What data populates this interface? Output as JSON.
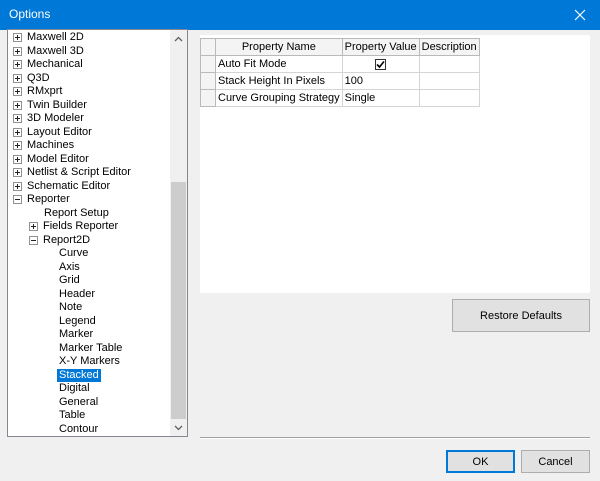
{
  "window": {
    "title": "Options"
  },
  "tree": {
    "items": [
      {
        "label": "Maxwell 2D",
        "level": 0,
        "expander": "plus"
      },
      {
        "label": "Maxwell 3D",
        "level": 0,
        "expander": "plus"
      },
      {
        "label": "Mechanical",
        "level": 0,
        "expander": "plus"
      },
      {
        "label": "Q3D",
        "level": 0,
        "expander": "plus"
      },
      {
        "label": "RMxprt",
        "level": 0,
        "expander": "plus"
      },
      {
        "label": "Twin Builder",
        "level": 0,
        "expander": "plus"
      },
      {
        "label": "3D Modeler",
        "level": 0,
        "expander": "plus"
      },
      {
        "label": "Layout Editor",
        "level": 0,
        "expander": "plus"
      },
      {
        "label": "Machines",
        "level": 0,
        "expander": "plus"
      },
      {
        "label": "Model Editor",
        "level": 0,
        "expander": "plus"
      },
      {
        "label": "Netlist & Script Editor",
        "level": 0,
        "expander": "plus"
      },
      {
        "label": "Schematic Editor",
        "level": 0,
        "expander": "plus"
      },
      {
        "label": "Reporter",
        "level": 0,
        "expander": "minus"
      },
      {
        "label": "Report Setup",
        "level": 1,
        "expander": "none"
      },
      {
        "label": "Fields Reporter",
        "level": 1,
        "expander": "plus"
      },
      {
        "label": "Report2D",
        "level": 1,
        "expander": "minus"
      },
      {
        "label": "Curve",
        "level": 2,
        "expander": "none"
      },
      {
        "label": "Axis",
        "level": 2,
        "expander": "none"
      },
      {
        "label": "Grid",
        "level": 2,
        "expander": "none"
      },
      {
        "label": "Header",
        "level": 2,
        "expander": "none"
      },
      {
        "label": "Note",
        "level": 2,
        "expander": "none"
      },
      {
        "label": "Legend",
        "level": 2,
        "expander": "none"
      },
      {
        "label": "Marker",
        "level": 2,
        "expander": "none"
      },
      {
        "label": "Marker Table",
        "level": 2,
        "expander": "none"
      },
      {
        "label": "X-Y Markers",
        "level": 2,
        "expander": "none"
      },
      {
        "label": "Stacked",
        "level": 2,
        "expander": "none",
        "selected": true
      },
      {
        "label": "Digital",
        "level": 2,
        "expander": "none"
      },
      {
        "label": "General",
        "level": 2,
        "expander": "none"
      },
      {
        "label": "Table",
        "level": 2,
        "expander": "none"
      },
      {
        "label": "Contour",
        "level": 2,
        "expander": "none"
      }
    ]
  },
  "grid": {
    "headers": [
      "Property Name",
      "Property Value",
      "Description"
    ],
    "rows": [
      {
        "name": "Auto Fit Mode",
        "value": "",
        "checked": true,
        "description": ""
      },
      {
        "name": "Stack Height In Pixels",
        "value": "100",
        "checked": null,
        "description": ""
      },
      {
        "name": "Curve Grouping Strategy",
        "value": "Single",
        "checked": null,
        "description": ""
      }
    ]
  },
  "buttons": {
    "restore_defaults": "Restore Defaults",
    "ok": "OK",
    "cancel": "Cancel"
  },
  "colors": {
    "titlebar": "#0078d7",
    "selection": "#0078d7"
  }
}
